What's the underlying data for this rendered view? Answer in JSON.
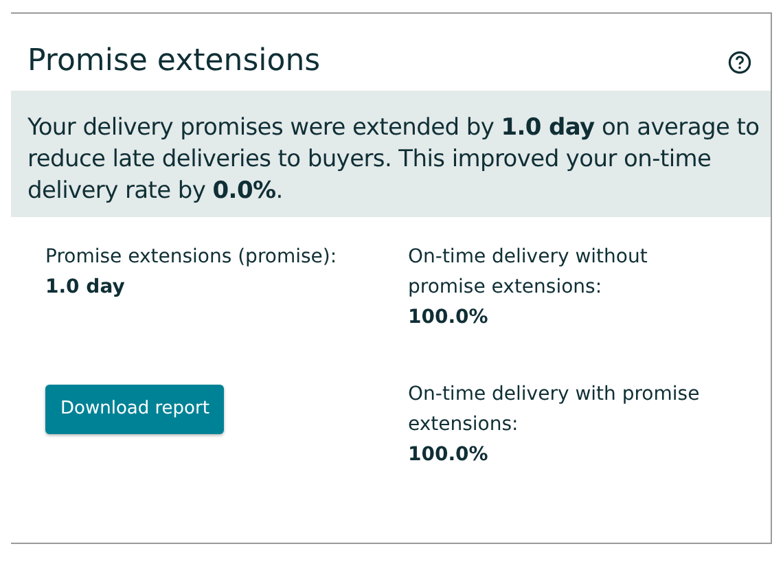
{
  "card": {
    "title": "Promise extensions",
    "summary": "Your delivery promises were extended by **1.0 day** on average to reduce late deliveries to buyers. This improved your on-time delivery rate by **0.0%**.",
    "metrics": [
      {
        "label": "Promise extensions (promise):",
        "value": "1.0 day"
      },
      {
        "label": "On-time delivery without promise extensions:",
        "value": "100.0%"
      },
      {
        "label": "On-time delivery with promise extensions:",
        "value": "100.0%"
      }
    ],
    "button": "Download report"
  }
}
